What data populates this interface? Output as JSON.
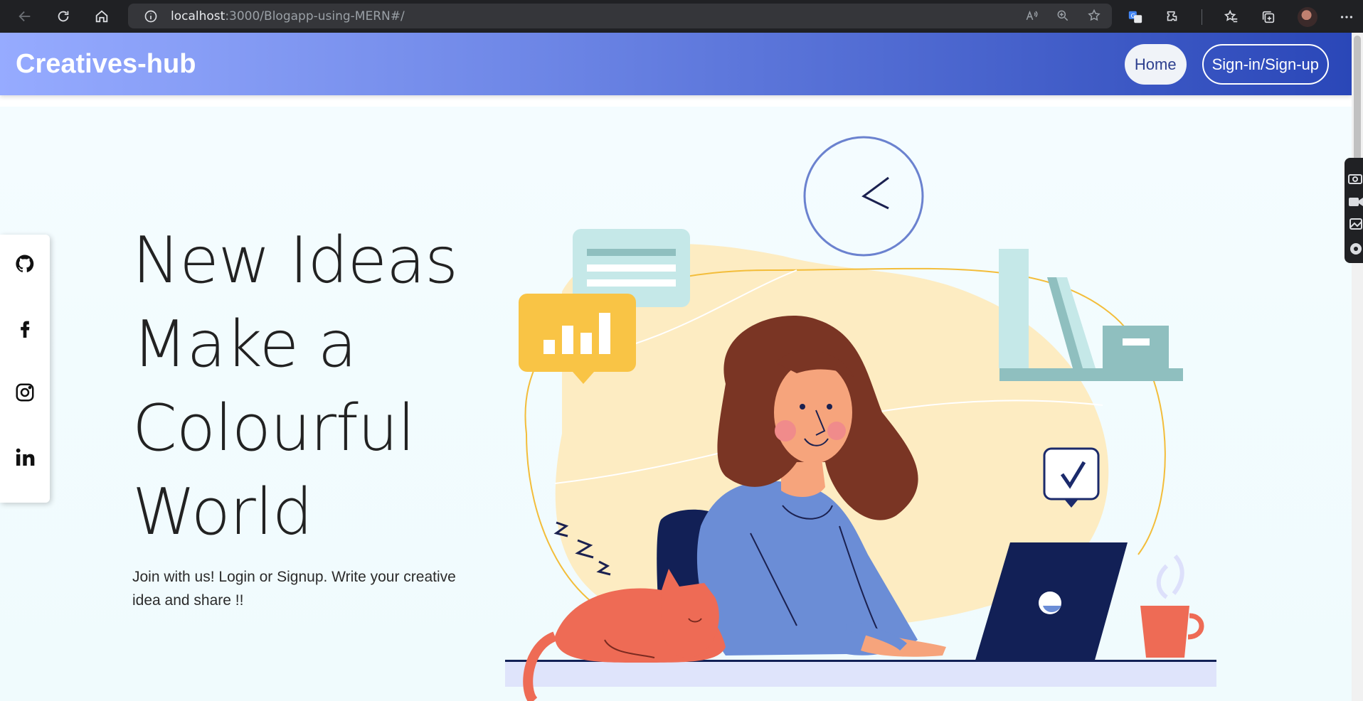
{
  "browser": {
    "url_host": "localhost",
    "url_path": ":3000/Blogapp-using-MERN#/",
    "icons": [
      "back-icon",
      "reload-icon",
      "home-icon",
      "info-icon",
      "read-aloud-icon",
      "zoom-icon",
      "favorite-add-icon",
      "translate-icon",
      "extensions-icon",
      "favorites-icon",
      "collections-icon",
      "profile-avatar",
      "more-icon"
    ]
  },
  "header": {
    "brand": "Creatives-hub",
    "home_label": "Home",
    "signin_label": "Sign-in/Sign-up"
  },
  "social": [
    "github-icon",
    "facebook-icon",
    "instagram-icon",
    "linkedin-icon"
  ],
  "hero": {
    "headline_lines": [
      "New Ideas",
      "Make a",
      "Colourful",
      "World"
    ],
    "tagline": "Join with us! Login or Signup. Write your creative idea and share !!"
  },
  "colors": {
    "header_start": "#96abff",
    "header_end": "#2a47b8",
    "hero_bg": "#f4fcff"
  }
}
